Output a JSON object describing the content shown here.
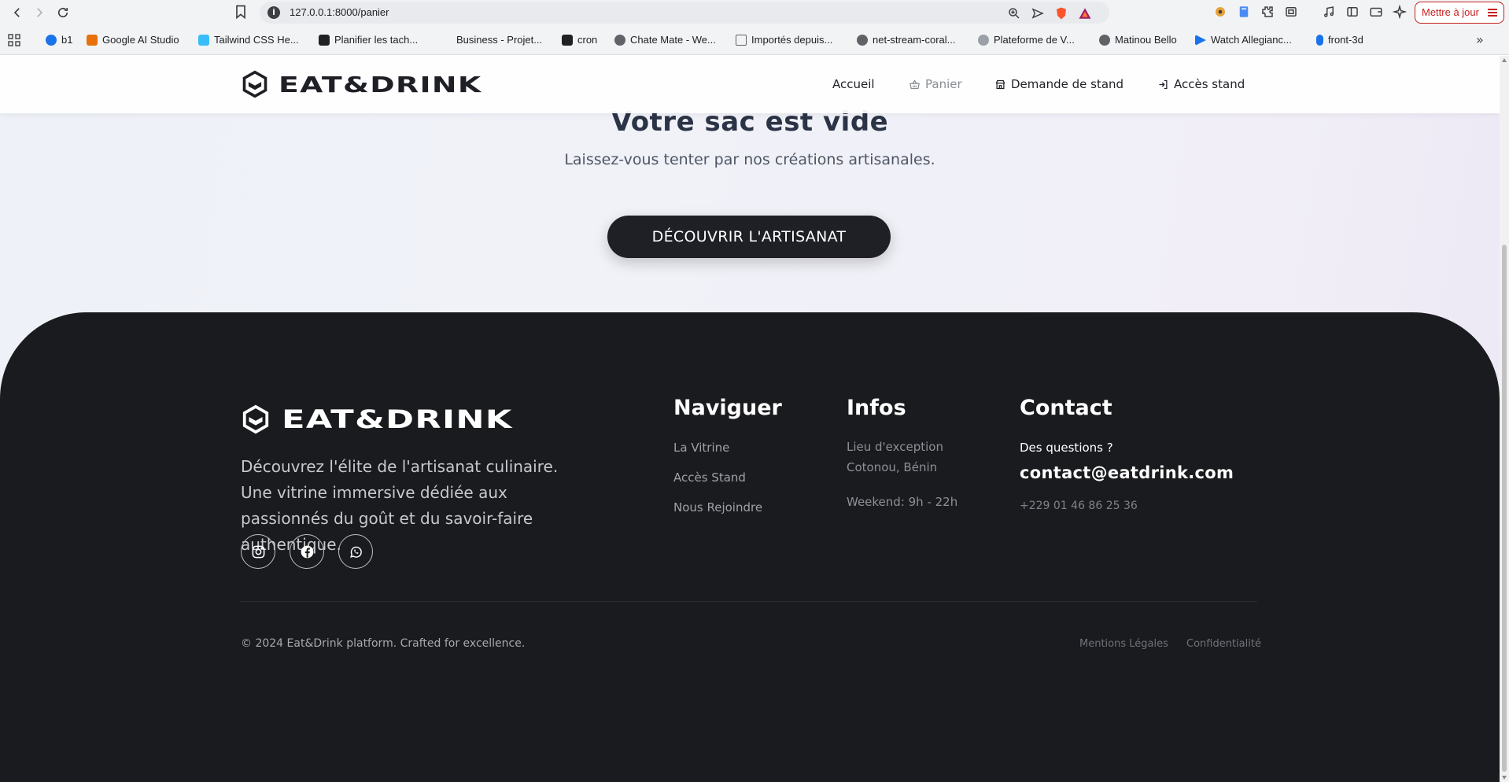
{
  "browser": {
    "url": "127.0.0.1:8000/panier",
    "update_label": "Mettre à jour",
    "bookmarks": [
      {
        "label": "b1",
        "color": "#1a73e8"
      },
      {
        "label": "Google AI Studio",
        "color": "#e8710a"
      },
      {
        "label": "Tailwind CSS He...",
        "color": "#38bdf8"
      },
      {
        "label": "Planifier les tach...",
        "color": "#202124"
      },
      {
        "label": "Business - Projet...",
        "color": "#f2f3f5"
      },
      {
        "label": "cron",
        "color": "#202124"
      },
      {
        "label": "Chate Mate - We...",
        "color": "#5f6368"
      },
      {
        "label": "Importés depuis...",
        "color": "#5f6368"
      },
      {
        "label": "net-stream-coral...",
        "color": "#5f6368"
      },
      {
        "label": "Plateforme de V...",
        "color": "#9aa0a6"
      },
      {
        "label": "Matinou Bello",
        "color": "#5f6368"
      },
      {
        "label": "Watch Allegianc...",
        "color": "#1a73e8"
      },
      {
        "label": "front-3d",
        "color": "#1a73e8"
      }
    ]
  },
  "header": {
    "brand": "EAT&DRINK",
    "nav": [
      {
        "label": "Accueil"
      },
      {
        "label": "Panier"
      },
      {
        "label": "Demande de stand"
      },
      {
        "label": "Accès stand"
      }
    ]
  },
  "cart": {
    "empty_title": "Votre sac est vide",
    "empty_subtitle": "Laissez-vous tenter par nos créations artisanales.",
    "cta_label": "DÉCOUVRIR L'ARTISANAT"
  },
  "footer": {
    "brand": "EAT&DRINK",
    "description": "Découvrez l'élite de l'artisanat culinaire. Une vitrine immersive dédiée aux passionnés du goût et du savoir-faire authentique.",
    "columns": {
      "nav": {
        "title": "Naviguer",
        "links": [
          "La Vitrine",
          "Accès Stand",
          "Nous Rejoindre"
        ]
      },
      "infos": {
        "title": "Infos",
        "place_line1": "Lieu d'exception",
        "place_line2": "Cotonou, Bénin",
        "hours": "Weekend: 9h - 22h"
      },
      "contact": {
        "title": "Contact",
        "question": "Des questions ?",
        "email": "contact@eatdrink.com",
        "phone": "+229 01 46 86 25 36"
      }
    },
    "copyright": "© 2024 Eat&Drink platform. Crafted for excellence.",
    "legal": [
      "Mentions Légales",
      "Confidentialité"
    ]
  }
}
